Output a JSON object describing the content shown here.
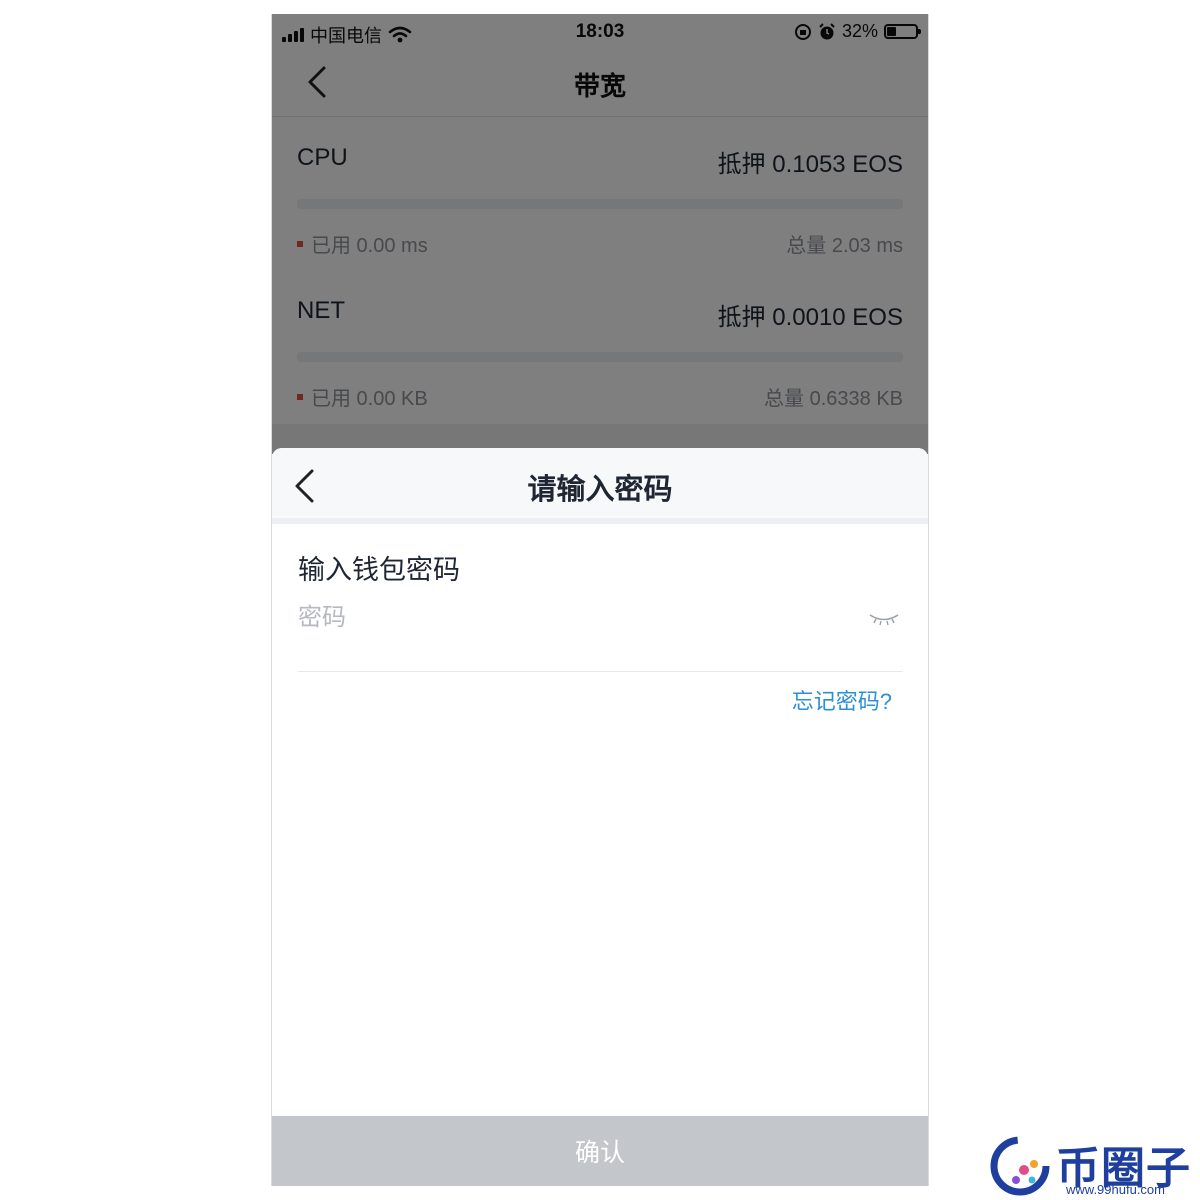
{
  "status_bar": {
    "carrier": "中国电信",
    "time": "18:03",
    "battery": "32%",
    "battery_level": 0.32
  },
  "page": {
    "title": "带宽",
    "resources": [
      {
        "name": "CPU",
        "stake": "抵押 0.1053 EOS",
        "used": "已用 0.00 ms",
        "total": "总量 2.03 ms",
        "used_fraction": 0
      },
      {
        "name": "NET",
        "stake": "抵押 0.0010 EOS",
        "used": "已用 0.00 KB",
        "total": "总量 0.6338 KB",
        "used_fraction": 0
      }
    ]
  },
  "dialog": {
    "title": "请输入密码",
    "label": "输入钱包密码",
    "password_placeholder": "密码",
    "password_value": "",
    "forgot_link": "忘记密码?",
    "confirm_label": "确认"
  },
  "watermark": {
    "text": "币圈子",
    "url": "www.99hufu.com"
  },
  "colors": {
    "accent_link": "#2d8fd5",
    "used_dot": "#e2513d",
    "confirm_disabled": "#c3c7cc",
    "watermark": "#1f3f9e"
  }
}
